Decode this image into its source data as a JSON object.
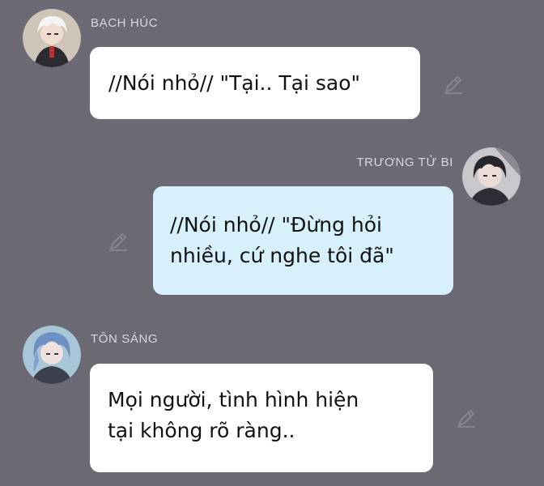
{
  "chat": {
    "messages": [
      {
        "sender": "BẠCH HÚC",
        "side": "left",
        "lines": [
          "//Nói nhỏ// \"Tại.. Tại sao\""
        ]
      },
      {
        "sender": "TRƯƠNG TỬ BI",
        "side": "right",
        "lines": [
          "//Nói nhỏ// \"Đừng hỏi",
          "nhiều, cứ nghe tôi đã\""
        ]
      },
      {
        "sender": "TÔN SÁNG",
        "side": "left",
        "lines": [
          "Mọi người, tình hình hiện",
          "tại không rõ ràng.."
        ]
      }
    ]
  },
  "icons": {
    "edit": "pencil-icon"
  },
  "colors": {
    "background": "#6b6a74",
    "bubble_white": "#ffffff",
    "bubble_blue": "#d6f1fb",
    "sender_text": "#d9d8de",
    "icon": "#86858d"
  }
}
